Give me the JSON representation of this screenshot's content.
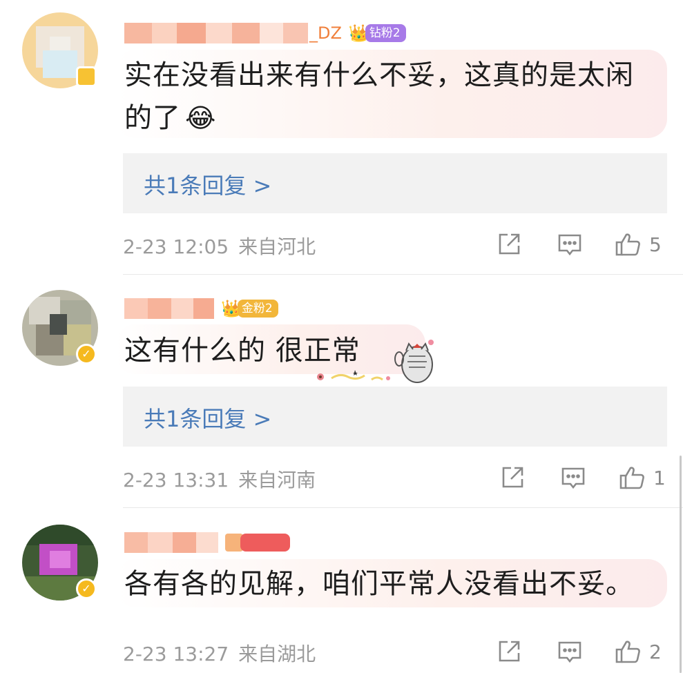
{
  "comments": [
    {
      "username_suffix": "_DZ",
      "fan_badge": "钻粉2",
      "fan_color": "#a77ae8",
      "text_line1": "实在没看出来有什么不妥，这真的是太闲",
      "text_line2": "的了",
      "emoji": "😂",
      "reply_label": "共1条回复 >",
      "time": "2-23 12:05",
      "location": "来自河北",
      "like_count": "5"
    },
    {
      "fan_badge": "金粉2",
      "fan_color": "#f2b63a",
      "text_line1": "这有什么的  很正常",
      "reply_label": "共1条回复 >",
      "time": "2-23 13:31",
      "location": "来自河南",
      "like_count": "1"
    },
    {
      "text_line1": "各有各的见解，咱们平常人没看出不妥。",
      "time": "2-23 13:27",
      "location": "来自湖北",
      "like_count": "2"
    }
  ]
}
